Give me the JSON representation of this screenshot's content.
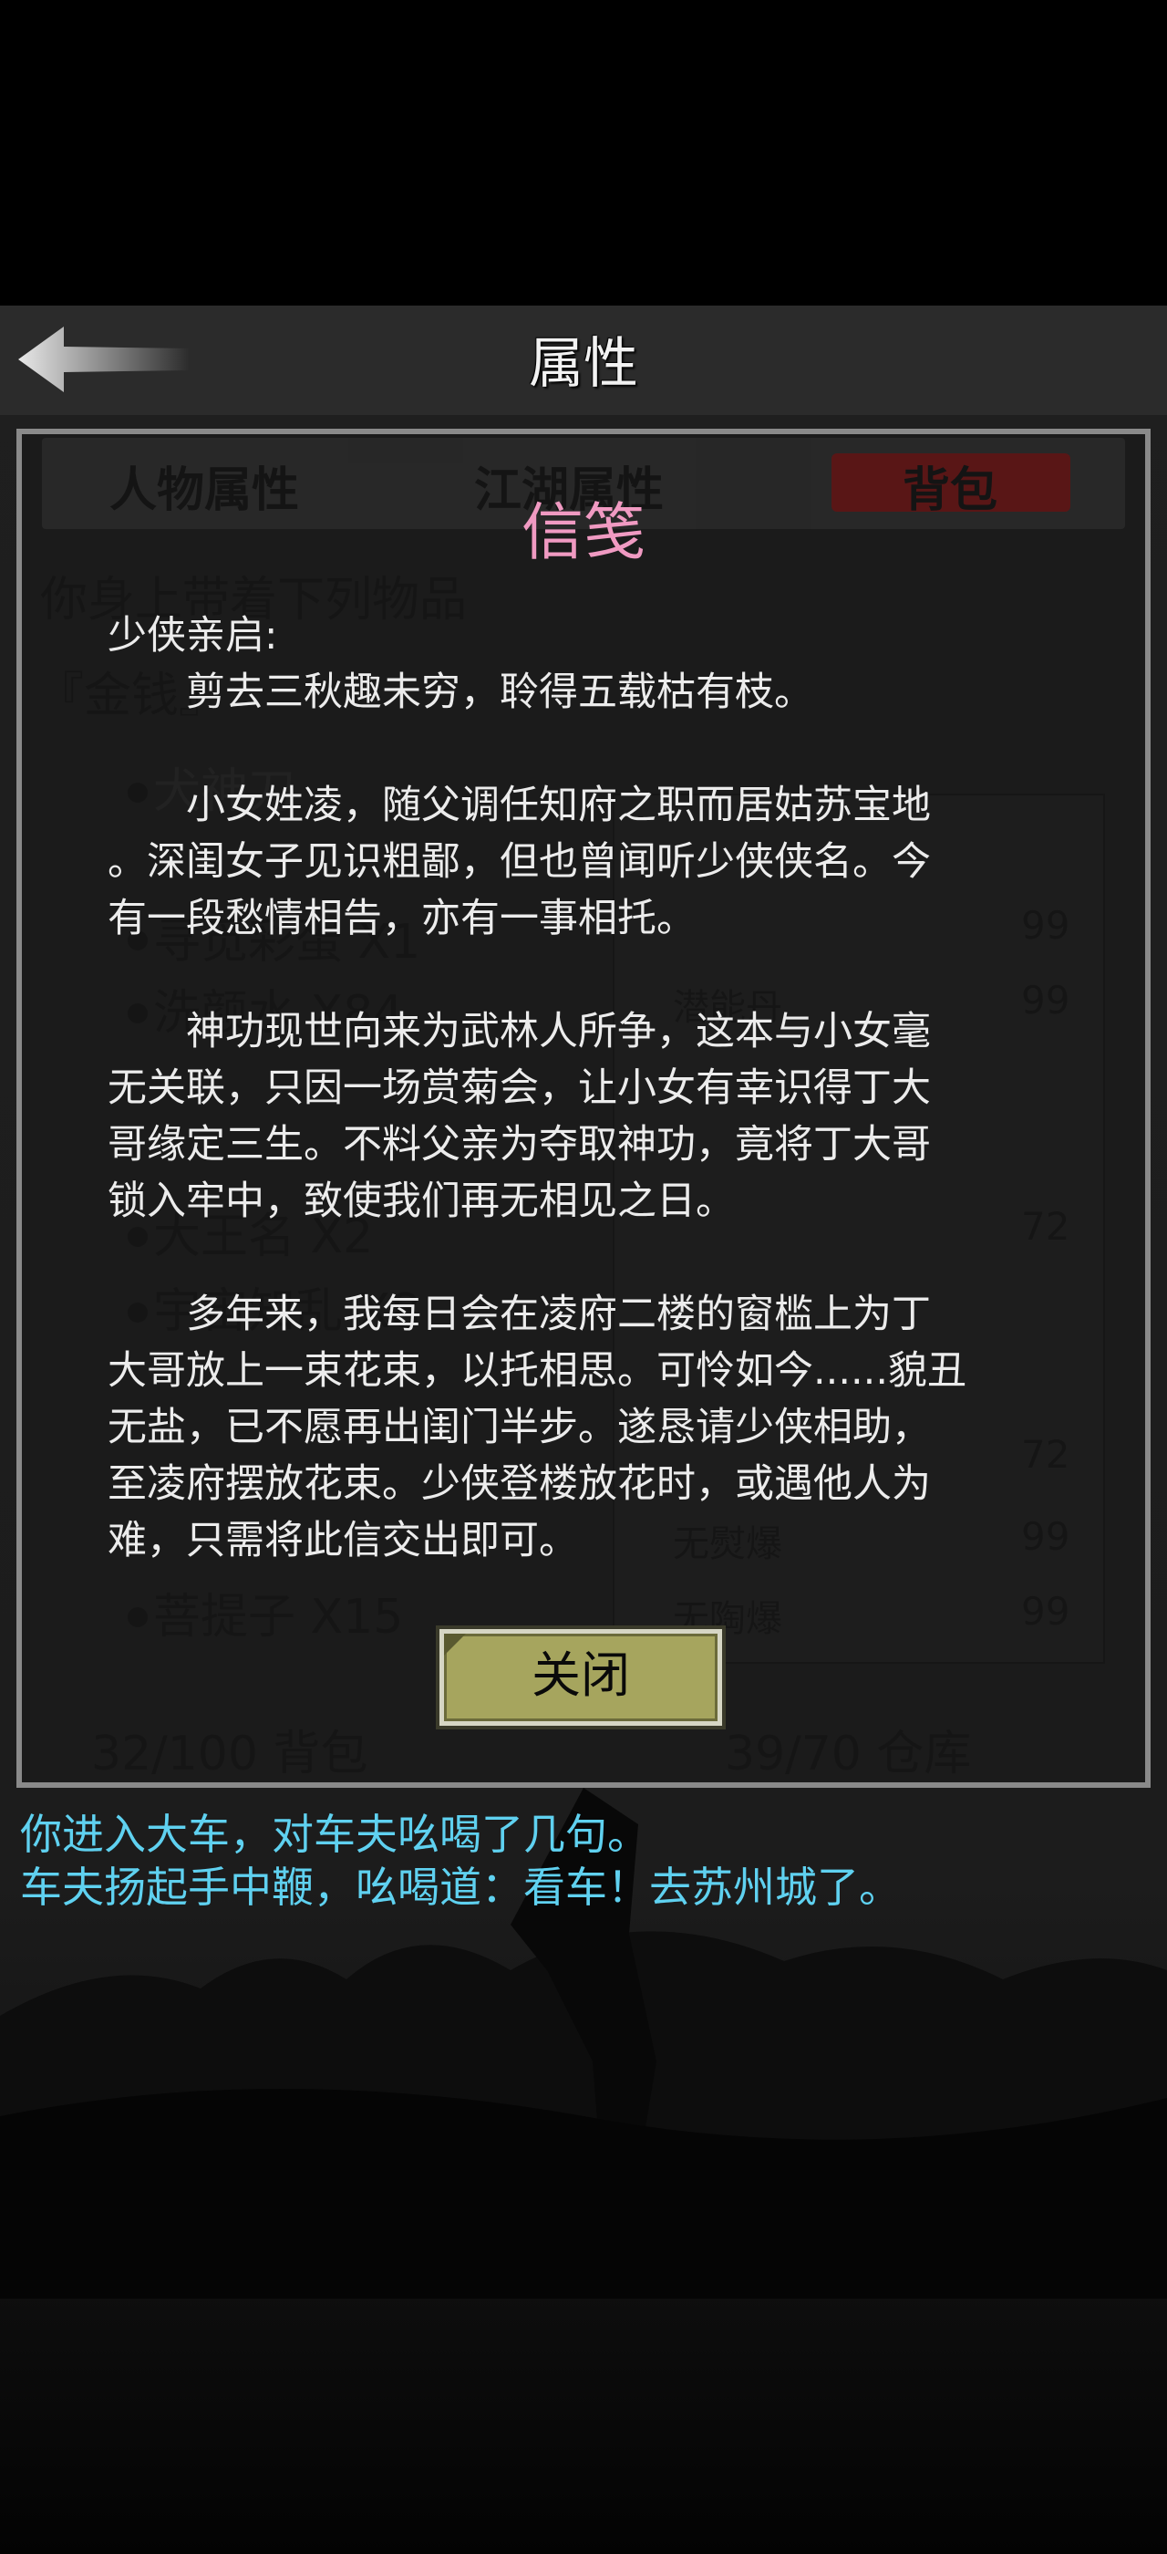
{
  "header": {
    "title": "属性",
    "back_icon": "back-arrow-icon"
  },
  "tabs": [
    {
      "label": "人物属性",
      "active": false
    },
    {
      "label": "江湖属性",
      "active": false
    },
    {
      "label": "背包",
      "active": true
    }
  ],
  "inventory": {
    "heading": "你身上带着下列物品",
    "money_row": "『金钱』",
    "items_left": [
      "犬神刀",
      "寻觅彩蛋 X1",
      "洗颜水 X84",
      "大王名 X2",
      "宇宙知乱 X8",
      "菩提子 X15"
    ],
    "items_right": [
      "潜能丹",
      "无熨爆",
      "无陶爆"
    ],
    "numbers_right": [
      "99",
      "99",
      "72",
      "72",
      "99",
      "99"
    ],
    "bag_count": "32/100 背包",
    "warehouse_count": "39/70 仓库"
  },
  "letter": {
    "title": "信笺",
    "salutation": "少侠亲启:",
    "paragraphs": [
      "　　剪去三秋趣未穷，聆得五载枯有枝。",
      "　　小女姓凌，随父调任知府之职而居姑苏宝地\n。深闺女子见识粗鄙，但也曾闻听少侠侠名。今\n有一段愁情相告，亦有一事相托。",
      "　　神功现世向来为武林人所争，这本与小女毫\n无关联，只因一场赏菊会，让小女有幸识得丁大\n哥缘定三生。不料父亲为夺取神功，竟将丁大哥\n锁入牢中，致使我们再无相见之日。",
      "　　多年来，我每日会在凌府二楼的窗槛上为丁\n大哥放上一束花束，以托相思。可怜如今......貌丑\n无盐，已不愿再出闺门半步。遂恳请少侠相助，\n至凌府摆放花束。少侠登楼放花时，或遇他人为\n难，只需将此信交出即可。"
    ],
    "close_label": "关闭"
  },
  "log": [
    "你进入大车，对车夫吆喝了几句。",
    "车夫扬起手中鞭，吆喝道：看车！去苏州城了。"
  ],
  "colors": {
    "letter_title": "#f09ac2",
    "log_text": "#5fd1f0",
    "button_bg": "#a6a55e",
    "active_tab": "#b01010"
  }
}
